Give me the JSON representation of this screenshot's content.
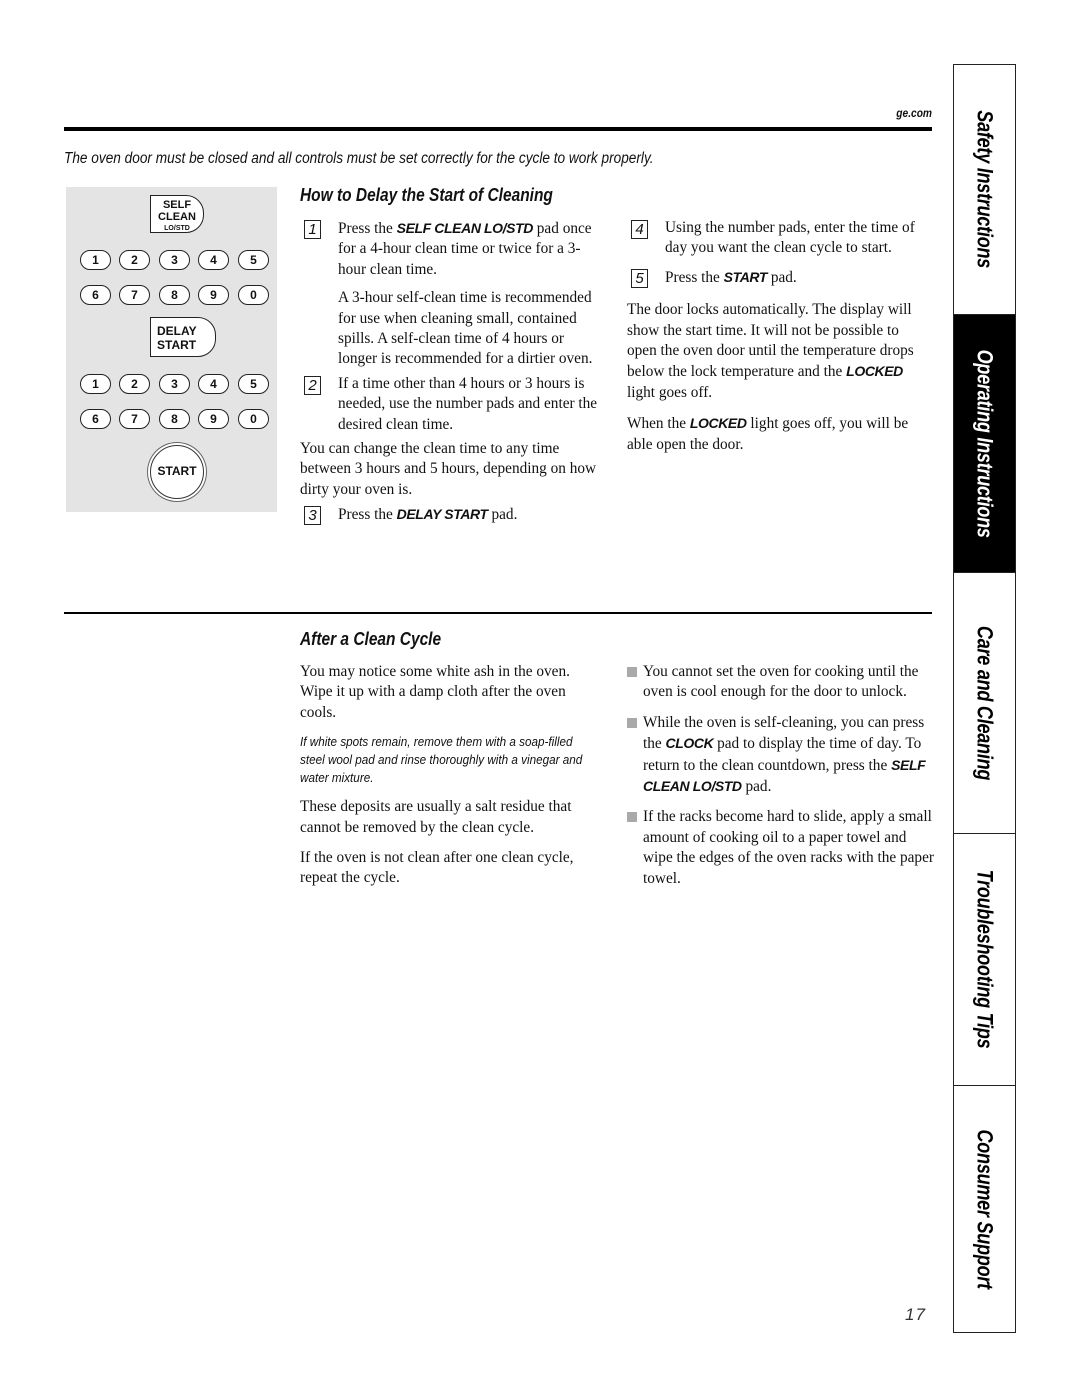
{
  "header": {
    "site": "ge.com",
    "intro": "The oven door must be closed and all controls must be set correctly for the cycle to work properly."
  },
  "keypad": {
    "self_clean": [
      "SELF",
      "CLEAN",
      "LO/STD"
    ],
    "delay_start": [
      "DELAY",
      "START"
    ],
    "digits_row1": [
      "1",
      "2",
      "3",
      "4",
      "5"
    ],
    "digits_row2": [
      "6",
      "7",
      "8",
      "9",
      "0"
    ],
    "start": "START"
  },
  "delay_section": {
    "title": "How to Delay the Start of Cleaning",
    "step1": {
      "num": "1",
      "pre": "Press the ",
      "bold": "SELF CLEAN LO/STD",
      "post": " pad once for a 4-hour clean time or twice for a 3-hour clean time."
    },
    "step1_note": "A 3-hour self-clean time is recommended for use when cleaning small, contained spills. A self-clean time of 4 hours or longer is recommended for a dirtier oven.",
    "step2": {
      "num": "2",
      "text": "If a time other than 4 hours or 3 hours is needed, use the number pads and enter the desired clean time."
    },
    "change_note": "You can change the clean time to any time between 3 hours and 5 hours, depending on how dirty your oven is.",
    "step3": {
      "num": "3",
      "pre": "Press the ",
      "bold": "DELAY START",
      "post": " pad."
    },
    "step4": {
      "num": "4",
      "text": "Using the number pads, enter the time of day you want the clean cycle to start."
    },
    "step5": {
      "num": "5",
      "pre": "Press the ",
      "bold": "START",
      "post": " pad."
    },
    "lock_pre": "The door locks automatically. The display will show the start time. It will not be possible to open the oven door until the temperature drops below the lock temperature and the ",
    "lock_bold": "LOCKED",
    "lock_post": " light goes off.",
    "open_pre": "When the ",
    "open_bold": "LOCKED",
    "open_post": " light goes off, you will be able open the door."
  },
  "after_section": {
    "title": "After a Clean Cycle",
    "p1": "You may notice some white ash in the oven. Wipe it up with a damp cloth after the oven cools.",
    "note": "If white spots remain, remove them with a soap-filled steel wool pad and rinse thoroughly with a vinegar and water mixture.",
    "p2": "These deposits are usually a salt residue that cannot be removed by the clean cycle.",
    "p3": "If the oven is not clean after one clean cycle, repeat the cycle.",
    "bullet1": "You cannot set the oven for cooking until the oven is cool enough for the door to unlock.",
    "bullet2_pre": "While the oven is self-cleaning, you can press the ",
    "bullet2_bold1": "CLOCK",
    "bullet2_mid": " pad to display the time of day. To return to the clean countdown, press the ",
    "bullet2_bold2": "SELF CLEAN LO/STD",
    "bullet2_post": " pad.",
    "bullet3": "If the racks become hard to slide, apply a small amount of cooking oil to a paper towel and wipe the edges of the oven racks with the paper towel."
  },
  "side_tabs": [
    {
      "label": "Safety Instructions",
      "active": false
    },
    {
      "label": "Operating Instructions",
      "active": true
    },
    {
      "label": "Care and Cleaning",
      "active": false
    },
    {
      "label": "Troubleshooting Tips",
      "active": false
    },
    {
      "label": "Consumer Support",
      "active": false
    }
  ],
  "page_number": "17"
}
